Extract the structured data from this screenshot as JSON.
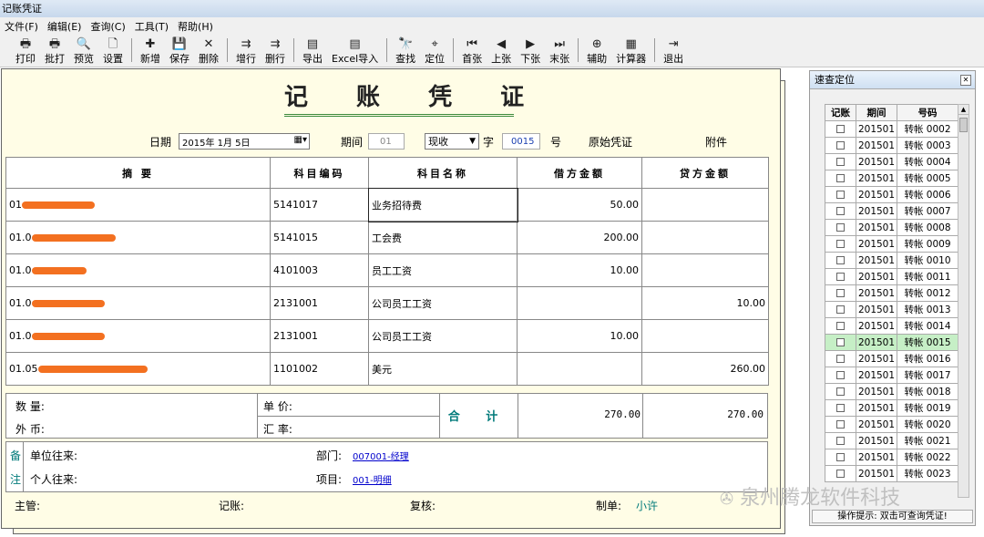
{
  "window": {
    "title": "记账凭证"
  },
  "menu": [
    "文件(F)",
    "编辑(E)",
    "查询(C)",
    "工具(T)",
    "帮助(H)"
  ],
  "toolbar": [
    {
      "label": "打印",
      "icon": "printer-icon",
      "glyph": "🖶"
    },
    {
      "label": "批打",
      "icon": "batch-print-icon",
      "glyph": "🖶"
    },
    {
      "label": "预览",
      "icon": "preview-icon",
      "glyph": "🔍"
    },
    {
      "label": "设置",
      "icon": "page-setup-icon",
      "glyph": "🗋"
    },
    {
      "label": "新增",
      "icon": "add-icon",
      "glyph": "✚"
    },
    {
      "label": "保存",
      "icon": "save-icon",
      "glyph": "💾"
    },
    {
      "label": "删除",
      "icon": "delete-icon",
      "glyph": "✕"
    },
    {
      "label": "增行",
      "icon": "insert-row-icon",
      "glyph": "⇉"
    },
    {
      "label": "删行",
      "icon": "delete-row-icon",
      "glyph": "⇉"
    },
    {
      "label": "导出",
      "icon": "export-icon",
      "glyph": "▤"
    },
    {
      "label": "Excel导入",
      "icon": "excel-import-icon",
      "glyph": "▤"
    },
    {
      "label": "查找",
      "icon": "find-icon",
      "glyph": "🔭"
    },
    {
      "label": "定位",
      "icon": "locate-icon",
      "glyph": "⌖"
    },
    {
      "label": "首张",
      "icon": "first-icon",
      "glyph": "⏮"
    },
    {
      "label": "上张",
      "icon": "prev-icon",
      "glyph": "◀"
    },
    {
      "label": "下张",
      "icon": "next-icon",
      "glyph": "▶"
    },
    {
      "label": "末张",
      "icon": "last-icon",
      "glyph": "⏭"
    },
    {
      "label": "辅助",
      "icon": "assist-icon",
      "glyph": "⊕"
    },
    {
      "label": "计算器",
      "icon": "calculator-icon",
      "glyph": "▦"
    },
    {
      "label": "退出",
      "icon": "exit-icon",
      "glyph": "⇥"
    }
  ],
  "voucher": {
    "title": "记 账 凭 证",
    "date_label": "日期",
    "date_value": "2015年 1月 5日",
    "period_label": "期间",
    "period_value": "01",
    "type_value": "现收",
    "zi_label": "字",
    "number_value": "0015",
    "hao_label": "号",
    "original_label": "原始凭证",
    "attach_label": "附件",
    "columns": [
      "摘 要",
      "科目编码",
      "科目名称",
      "借方金额",
      "贷方金额"
    ],
    "rows": [
      {
        "summary": "01",
        "code": "5141017",
        "name": "业务招待费",
        "debit": "50.00",
        "credit": ""
      },
      {
        "summary": "01.0",
        "code": "5141015",
        "name": "工会费",
        "debit": "200.00",
        "credit": ""
      },
      {
        "summary": "01.0",
        "code": "4101003",
        "name": "员工工资",
        "debit": "10.00",
        "credit": ""
      },
      {
        "summary": "01.0",
        "code": "2131001",
        "name": "公司员工工资",
        "debit": "",
        "credit": "10.00"
      },
      {
        "summary": "01.0",
        "code": "2131001",
        "name": "公司员工工资",
        "debit": "10.00",
        "credit": ""
      },
      {
        "summary": "01.05",
        "code": "1101002",
        "name": "美元",
        "debit": "",
        "credit": "260.00"
      }
    ],
    "qty_label": "数 量:",
    "price_label": "单 价:",
    "fx_label": "外 币:",
    "rate_label": "汇 率:",
    "total_label": "合 计",
    "total_debit": "270.00",
    "total_credit": "270.00",
    "bei": "备",
    "zhu": "注",
    "unit_label": "单位往来:",
    "person_label": "个人往来:",
    "dept_label": "部门:",
    "dept_value": "007001-经理",
    "project_label": "项目:",
    "project_value": "001-明细",
    "supervisor_label": "主管:",
    "bookkeeper_label": "记账:",
    "reviewer_label": "复核:",
    "maker_label": "制单:",
    "maker_value": "小许"
  },
  "side": {
    "title": "速查定位",
    "columns": [
      "记账",
      "期间",
      "号码"
    ],
    "rows": [
      {
        "period": "201501",
        "num": "转帐 0002"
      },
      {
        "period": "201501",
        "num": "转帐 0003"
      },
      {
        "period": "201501",
        "num": "转帐 0004"
      },
      {
        "period": "201501",
        "num": "转帐 0005"
      },
      {
        "period": "201501",
        "num": "转帐 0006"
      },
      {
        "period": "201501",
        "num": "转帐 0007"
      },
      {
        "period": "201501",
        "num": "转帐 0008"
      },
      {
        "period": "201501",
        "num": "转帐 0009"
      },
      {
        "period": "201501",
        "num": "转帐 0010"
      },
      {
        "period": "201501",
        "num": "转帐 0011"
      },
      {
        "period": "201501",
        "num": "转帐 0012"
      },
      {
        "period": "201501",
        "num": "转帐 0013"
      },
      {
        "period": "201501",
        "num": "转帐 0014"
      },
      {
        "period": "201501",
        "num": "转帐 0015"
      },
      {
        "period": "201501",
        "num": "转帐 0016"
      },
      {
        "period": "201501",
        "num": "转帐 0017"
      },
      {
        "period": "201501",
        "num": "转帐 0018"
      },
      {
        "period": "201501",
        "num": "转帐 0019"
      },
      {
        "period": "201501",
        "num": "转帐 0020"
      },
      {
        "period": "201501",
        "num": "转帐 0021"
      },
      {
        "period": "201501",
        "num": "转帐 0022"
      },
      {
        "period": "201501",
        "num": "转帐 0023"
      }
    ],
    "selected_index": 13,
    "hint": "操作提示: 双击可查询凭证!"
  },
  "watermark": "泉州腾龙软件科技",
  "colors": {
    "voucher_bg": "#fffde6",
    "highlight_row": "#c6efc6",
    "accent_green": "#3c8a3c",
    "link_blue": "#0000cc",
    "teal": "#007a7a",
    "redaction": "#f37020"
  }
}
